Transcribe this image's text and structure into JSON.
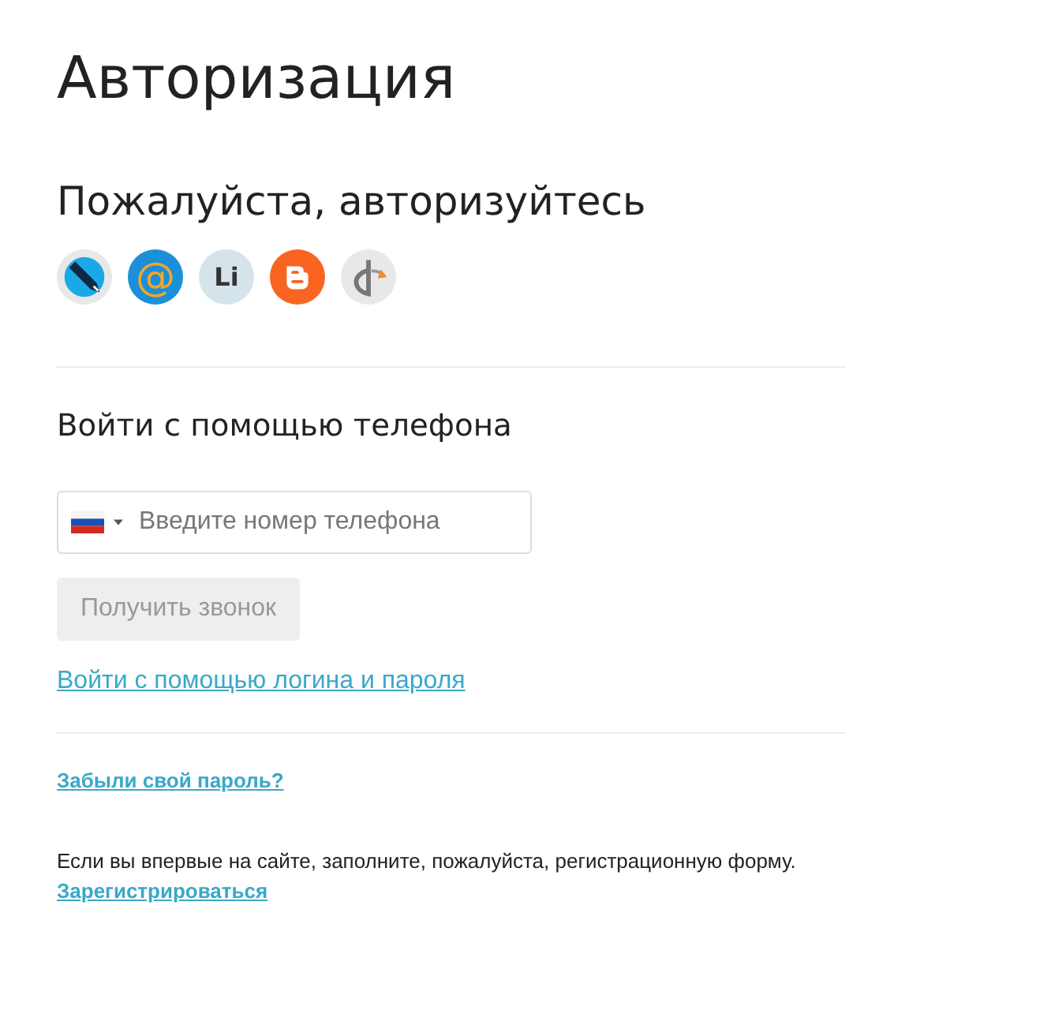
{
  "page": {
    "title": "Авторизация"
  },
  "social_login": {
    "heading": "Пожалуйста, авторизуйтесь",
    "providers": [
      {
        "kind": "pencil"
      },
      {
        "kind": "text",
        "label": "@"
      },
      {
        "kind": "text",
        "label": "Li"
      },
      {
        "kind": "blogger"
      },
      {
        "kind": "openid"
      }
    ]
  },
  "phone_login": {
    "heading": "Войти с помощью телефона",
    "phone_field": {
      "placeholder": "Введите номер телефона"
    },
    "call_button": {
      "label": "Получить звонок",
      "disabled": true
    },
    "password_login_link": "Войти с помощью логина и пароля"
  },
  "forgot_password_link": "Забыли свой пароль?",
  "registration": {
    "text": "Если вы впервые на сайте, заполните, пожалуйста, регистрационную форму.",
    "link": "Зарегистрироваться"
  }
}
